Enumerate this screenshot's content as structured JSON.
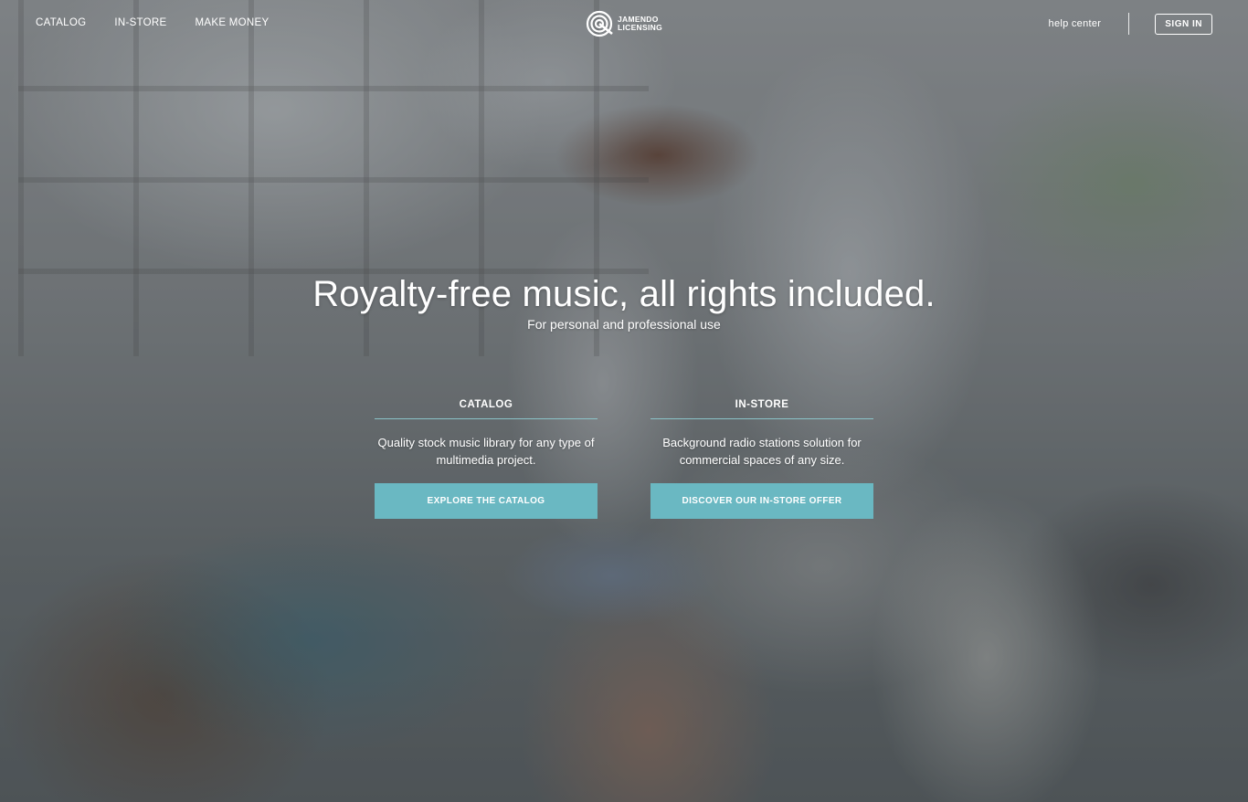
{
  "nav": {
    "links": [
      {
        "label": "CATALOG"
      },
      {
        "label": "IN-STORE"
      },
      {
        "label": "MAKE MONEY"
      }
    ],
    "logo": {
      "line1": "JAMENDO",
      "line2": "LICENSING"
    },
    "help_label": "help center",
    "signin_label": "SIGN IN"
  },
  "hero": {
    "headline": "Royalty-free music, all rights included.",
    "subheadline": "For personal and professional use"
  },
  "columns": {
    "catalog": {
      "title": "CATALOG",
      "description": "Quality stock music library for any type of multimedia project.",
      "button": "EXPLORE THE CATALOG"
    },
    "instore": {
      "title": "IN-STORE",
      "description": "Background radio stations solution for commercial spaces of any size.",
      "button": "DISCOVER OUR IN-STORE OFFER"
    }
  },
  "colors": {
    "accent": "#6ab8c2",
    "divider": "#8cc8cd"
  },
  "icons": {
    "logo": "jamendo-logo-icon"
  }
}
